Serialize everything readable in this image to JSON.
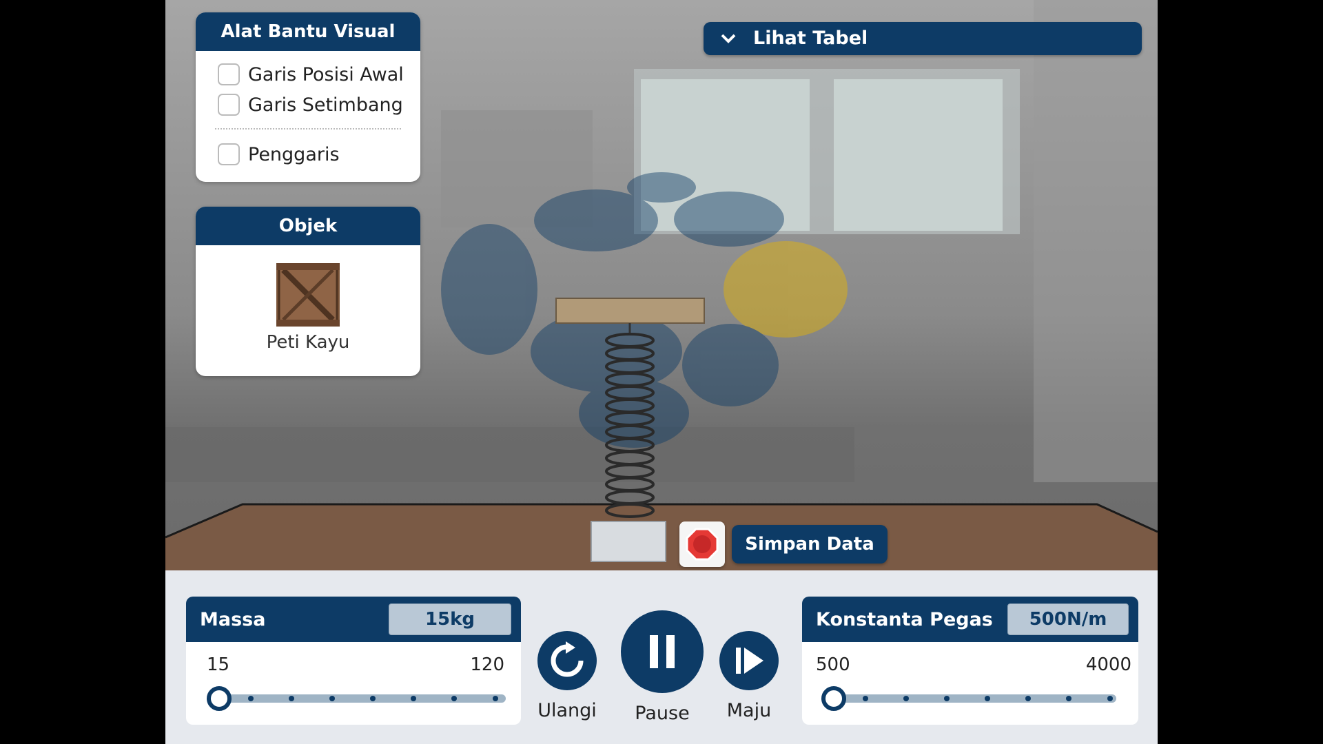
{
  "visual_aids": {
    "title": "Alat Bantu Visual",
    "options": [
      {
        "label": "Garis Posisi Awal",
        "checked": false
      },
      {
        "label": "Garis Setimbang",
        "checked": false
      },
      {
        "label": "Penggaris",
        "checked": false
      }
    ]
  },
  "objects": {
    "title": "Objek",
    "selected": {
      "label": "Peti Kayu",
      "icon": "wooden-crate-icon"
    }
  },
  "table_toggle": {
    "label": "Lihat Tabel",
    "icon": "chevron-down-icon"
  },
  "apparatus": {
    "stop_icon": "stop-icon",
    "save_label": "Simpan Data"
  },
  "mass": {
    "label": "Massa",
    "value": "15kg",
    "min": "15",
    "max": "120",
    "current": 15
  },
  "spring_constant": {
    "label": "Konstanta Pegas",
    "value": "500N/m",
    "min": "500",
    "max": "4000",
    "current": 500
  },
  "playback": {
    "reset_label": "Ulangi",
    "pause_label": "Pause",
    "step_label": "Maju"
  },
  "colors": {
    "primary": "#0d3b66",
    "slider_track": "#9fb4c5",
    "value_box": "#b9c8d6",
    "stop_red": "#e53935"
  }
}
